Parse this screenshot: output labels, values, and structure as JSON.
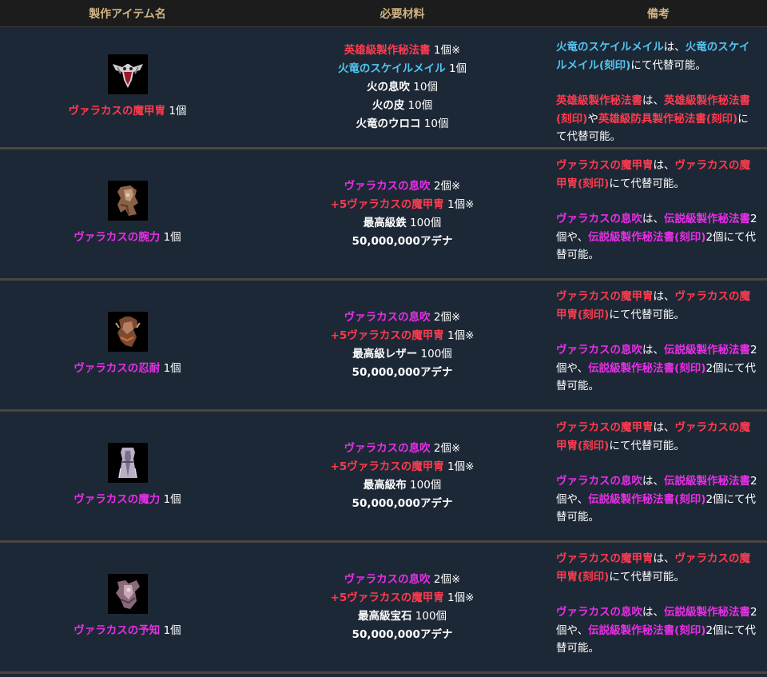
{
  "header": {
    "col_item": "製作アイテム名",
    "col_materials": "必要材料",
    "col_notes": "備考"
  },
  "colors": {
    "red": "#ff3b4e",
    "blue": "#52c5f0",
    "magenta": "#e82ee8",
    "header_text": "#d0b283"
  },
  "rows": [
    {
      "icon": "skull-armor-icon",
      "item_name": "ヴァラカスの魔甲冑",
      "item_qty": " 1個",
      "materials": [
        {
          "name": "英雄級製作秘法書",
          "qty": " 1個※"
        },
        {
          "name": "火竜のスケイルメイル",
          "qty": " 1個"
        },
        {
          "name": "火の息吹",
          "qty": " 10個"
        },
        {
          "name": "火の皮",
          "qty": " 10個"
        },
        {
          "name": "火竜のウロコ",
          "qty": " 10個"
        }
      ],
      "notes": [
        {
          "a": "火竜のスケイルメイル",
          "b": "は、",
          "c": "火竜のスケイルメイル(刻印)",
          "d": "にて代替可能。"
        },
        {
          "a": "英雄級製作秘法書",
          "b": "は、",
          "c": "英雄級製作秘法書(刻印)",
          "d": "や",
          "e": "英雄級防具製作秘法書(刻印)",
          "f": "にて代替可能。"
        }
      ]
    },
    {
      "icon": "gauntlet-icon",
      "item_name": "ヴァラカスの腕力",
      "item_qty": " 1個",
      "materials": [
        {
          "name": "ヴァラカスの息吹",
          "qty": " 2個※"
        },
        {
          "name": "+5ヴァラカスの魔甲冑",
          "qty": " 1個※"
        },
        {
          "name": "最高級鉄",
          "qty": " 100個"
        },
        {
          "name": "50,000,000アデナ",
          "qty": ""
        }
      ],
      "notes": [
        {
          "a": "ヴァラカスの魔甲冑",
          "b": "は、",
          "c": "ヴァラカスの魔甲冑(刻印)",
          "d": "にて代替可能。"
        },
        {
          "a": "ヴァラカスの息吹",
          "b": "は、",
          "c": "伝説級製作秘法書",
          "d": "2個や、",
          "e": "伝説級製作秘法書(刻印)",
          "f": "2個にて代替可能。"
        }
      ]
    },
    {
      "icon": "leather-armor-icon",
      "item_name": "ヴァラカスの忍耐",
      "item_qty": " 1個",
      "materials": [
        {
          "name": "ヴァラカスの息吹",
          "qty": " 2個※"
        },
        {
          "name": "+5ヴァラカスの魔甲冑",
          "qty": " 1個※"
        },
        {
          "name": "最高級レザー",
          "qty": " 100個"
        },
        {
          "name": "50,000,000アデナ",
          "qty": ""
        }
      ],
      "notes": [
        {
          "a": "ヴァラカスの魔甲冑",
          "b": "は、",
          "c": "ヴァラカスの魔甲冑(刻印)",
          "d": "にて代替可能。"
        },
        {
          "a": "ヴァラカスの息吹",
          "b": "は、",
          "c": "伝説級製作秘法書",
          "d": "2個や、",
          "e": "伝説級製作秘法書(刻印)",
          "f": "2個にて代替可能。"
        }
      ]
    },
    {
      "icon": "robe-icon",
      "item_name": "ヴァラカスの魔力",
      "item_qty": " 1個",
      "materials": [
        {
          "name": "ヴァラカスの息吹",
          "qty": " 2個※"
        },
        {
          "name": "+5ヴァラカスの魔甲冑",
          "qty": " 1個※"
        },
        {
          "name": "最高級布",
          "qty": " 100個"
        },
        {
          "name": "50,000,000アデナ",
          "qty": ""
        }
      ],
      "notes": [
        {
          "a": "ヴァラカスの魔甲冑",
          "b": "は、",
          "c": "ヴァラカスの魔甲冑(刻印)",
          "d": "にて代替可能。"
        },
        {
          "a": "ヴァラカスの息吹",
          "b": "は、",
          "c": "伝説級製作秘法書",
          "d": "2個や、",
          "e": "伝説級製作秘法書(刻印)",
          "f": "2個にて代替可能。"
        }
      ]
    },
    {
      "icon": "plate-armor-icon",
      "item_name": "ヴァラカスの予知",
      "item_qty": " 1個",
      "materials": [
        {
          "name": "ヴァラカスの息吹",
          "qty": " 2個※"
        },
        {
          "name": "+5ヴァラカスの魔甲冑",
          "qty": " 1個※"
        },
        {
          "name": "最高級宝石",
          "qty": " 100個"
        },
        {
          "name": "50,000,000アデナ",
          "qty": ""
        }
      ],
      "notes": [
        {
          "a": "ヴァラカスの魔甲冑",
          "b": "は、",
          "c": "ヴァラカスの魔甲冑(刻印)",
          "d": "にて代替可能。"
        },
        {
          "a": "ヴァラカスの息吹",
          "b": "は、",
          "c": "伝説級製作秘法書",
          "d": "2個や、",
          "e": "伝説級製作秘法書(刻印)",
          "f": "2個にて代替可能。"
        }
      ]
    }
  ]
}
